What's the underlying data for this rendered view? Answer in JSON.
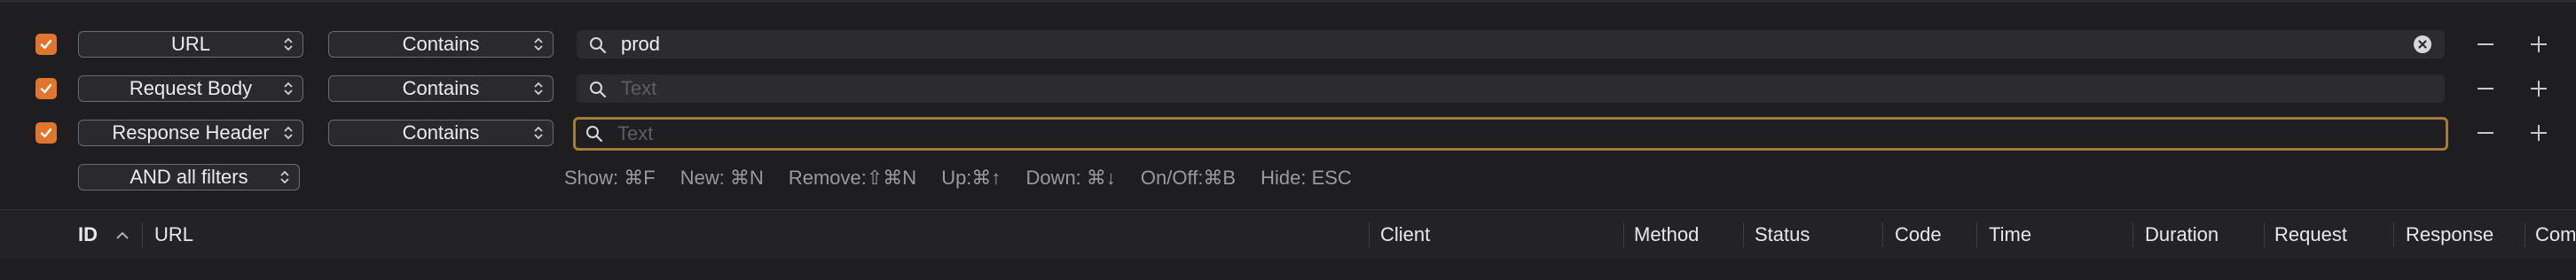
{
  "filters": [
    {
      "enabled": true,
      "field": "URL",
      "operator": "Contains",
      "value": "prod",
      "placeholder": "Text"
    },
    {
      "enabled": true,
      "field": "Request Body",
      "operator": "Contains",
      "value": "",
      "placeholder": "Text"
    },
    {
      "enabled": true,
      "field": "Response Header",
      "operator": "Contains",
      "value": "",
      "placeholder": "Text"
    }
  ],
  "combine_mode": "AND all filters",
  "shortcuts": [
    "Show: ⌘F",
    "New: ⌘N",
    "Remove:⇧⌘N",
    "Up:⌘↑",
    "Down: ⌘↓",
    "On/Off:⌘B",
    "Hide: ESC"
  ],
  "table": {
    "sort_column": "ID",
    "sort_direction": "ascending",
    "columns": [
      "ID",
      "URL",
      "Client",
      "Method",
      "Status",
      "Code",
      "Time",
      "Duration",
      "Request",
      "Response",
      "Comp"
    ]
  },
  "colors": {
    "checkbox": "#e0752d",
    "focus_ring": "#a47a3d",
    "background": "#1e1e20"
  },
  "icons": {
    "search": "magnifying-glass",
    "clear": "x-circle",
    "remove": "minus",
    "add": "plus",
    "sort": "chevron-up"
  }
}
